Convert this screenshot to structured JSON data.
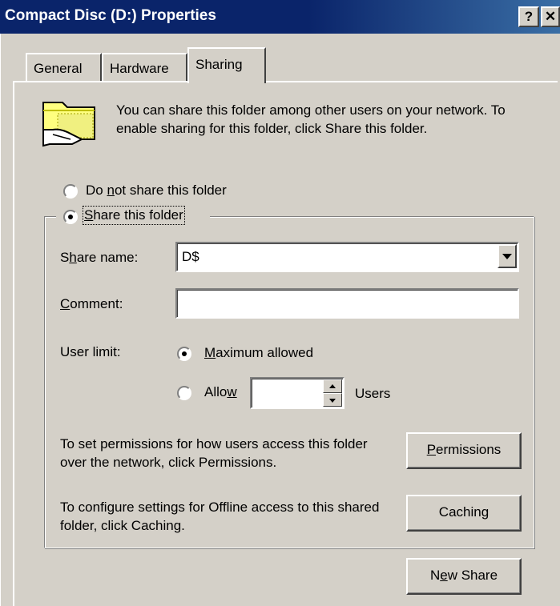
{
  "window": {
    "title": "Compact Disc (D:) Properties",
    "help_button": "?",
    "close_button": "✕"
  },
  "tabs": [
    {
      "label": "General",
      "active": false
    },
    {
      "label": "Hardware",
      "active": false
    },
    {
      "label": "Sharing",
      "active": true
    }
  ],
  "sharing": {
    "description": "You can share this folder among other users on your network.  To enable sharing for this folder, click Share this folder.",
    "do_not_share": {
      "pre": "Do ",
      "key": "n",
      "post": "ot share this folder",
      "selected": false
    },
    "share": {
      "pre": "",
      "key": "S",
      "post": "hare this folder",
      "selected": true
    },
    "share_name": {
      "label_pre": "S",
      "label_key": "h",
      "label_post": "are name:",
      "value": "D$"
    },
    "comment": {
      "label_key": "C",
      "label_post": "omment:",
      "value": ""
    },
    "user_limit": {
      "label": "User limit:",
      "maximum": {
        "key": "M",
        "post": "aximum allowed",
        "selected": true
      },
      "allow": {
        "pre": "Allo",
        "key": "w",
        "selected": false,
        "value": ""
      },
      "users_label": "Users"
    },
    "permissions": {
      "text": "To set permissions for how users access this folder over the network, click Permissions.",
      "button_key": "P",
      "button_post": "ermissions"
    },
    "caching": {
      "text": "To configure settings for Offline access to this shared folder, click Caching.",
      "button_pre": "Cachin",
      "button_key": "g"
    },
    "new_share": {
      "pre": "N",
      "key": "e",
      "post": "w Share"
    }
  },
  "colors": {
    "title_bar": "#0a246a",
    "dialog_face": "#d4d0c8",
    "folder_yellow": "#ffff80"
  }
}
